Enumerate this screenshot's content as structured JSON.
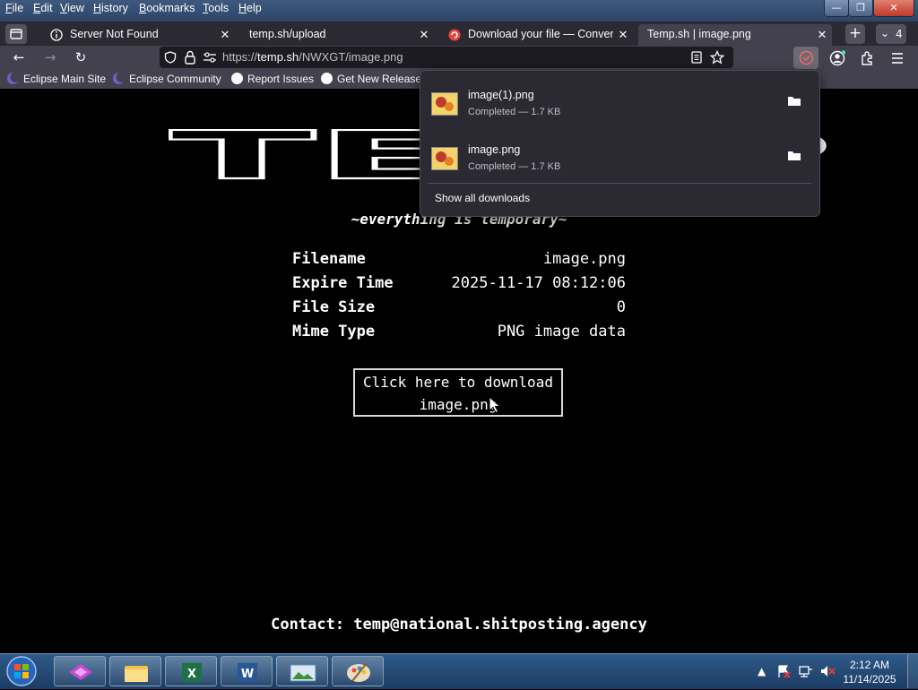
{
  "menu": [
    "File",
    "Edit",
    "View",
    "History",
    "Bookmarks",
    "Tools",
    "Help"
  ],
  "window_controls": {
    "minimize": "—",
    "maximize": "❐",
    "close": "✕"
  },
  "tabs": [
    {
      "label": "Server Not Found",
      "close": "✕"
    },
    {
      "label": "temp.sh/upload",
      "close": "✕"
    },
    {
      "label": "Download your file — Converti",
      "close": "✕"
    },
    {
      "label": "Temp.sh | image.png",
      "close": "✕",
      "active": true
    }
  ],
  "tab_overflow": {
    "new_tab": "+",
    "count": "4"
  },
  "nav": {
    "back": "←",
    "forward": "→",
    "reload": "↻"
  },
  "url": {
    "prefix": "https://",
    "host": "temp.sh",
    "path": "/NWXGT/image.png"
  },
  "bookmarks": [
    "Eclipse Main Site",
    "Eclipse Community",
    "Report Issues",
    "Get New Releases"
  ],
  "logo_text": "TEMP",
  "tagline": "~everything is temporary~",
  "info": [
    {
      "label": "Filename",
      "value": "image.png"
    },
    {
      "label": "Expire Time",
      "value": "2025-11-17 08:12:06"
    },
    {
      "label": "File Size",
      "value": "0"
    },
    {
      "label": "Mime Type",
      "value": "PNG image data"
    }
  ],
  "download_button": {
    "line1": "Click here to download",
    "line2": "image.png"
  },
  "contact": "Contact: temp@national.shitposting.agency",
  "downloads_panel": {
    "items": [
      {
        "name": "image(1).png",
        "status": "Completed — 1.7 KB"
      },
      {
        "name": "image.png",
        "status": "Completed — 1.7 KB"
      }
    ],
    "show_all": "Show all downloads"
  },
  "taskbar": {
    "time": "2:12 AM",
    "date": "11/14/2025"
  },
  "colors": {
    "accent": "#3fe1b0",
    "browser_chrome": "#42414d",
    "tab_bar": "#2b2a33",
    "page_bg": "#000000"
  }
}
